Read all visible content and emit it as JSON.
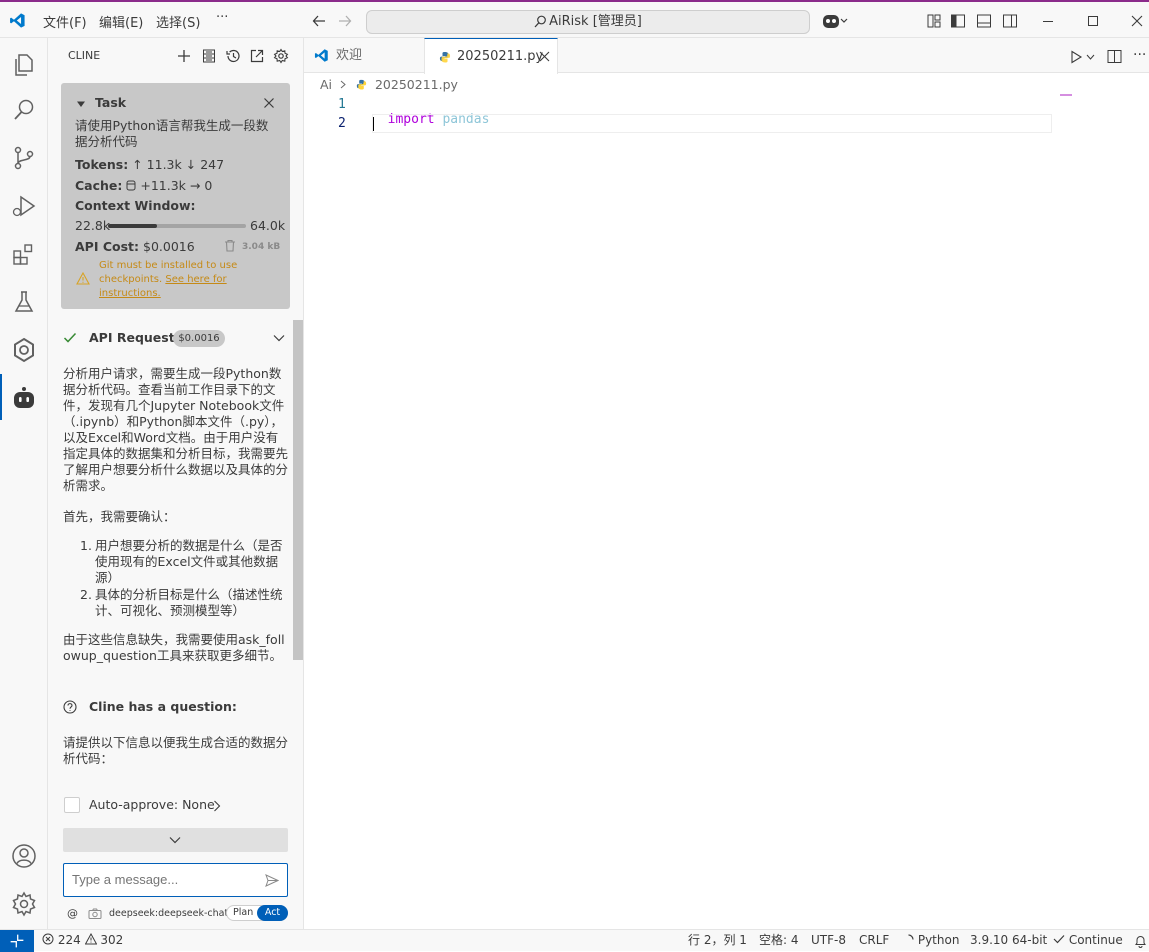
{
  "titlebar": {
    "menus": [
      "文件(F)",
      "编辑(E)",
      "选择(S)",
      "···"
    ],
    "command_center": "AiRisk [管理员]"
  },
  "activity": {
    "items": [
      "explorer-icon",
      "search-icon",
      "source-control-icon",
      "run-debug-icon",
      "extensions-icon",
      "testing-icon",
      "openai-icon",
      "cline-icon"
    ],
    "bottom": [
      "account-icon",
      "settings-gear-icon"
    ]
  },
  "cline": {
    "header": "CLINE",
    "task": {
      "title": "Task",
      "text": "请使用Python语言帮我生成一段数据分析代码",
      "tokens_label": "Tokens:",
      "tokens_up": "↑ 11.3k",
      "tokens_down": "↓ 247",
      "cache_label": "Cache:",
      "cache_value": "+11.3k → 0",
      "context_label": "Context Window:",
      "context_used": "22.8k",
      "context_max": "64.0k",
      "context_fraction": 0.356,
      "cost_label": "API Cost:",
      "cost_value": "$0.0016",
      "size": "3.04 kB",
      "git_warning": "Git must be installed to use checkpoints.",
      "git_link": "See here for instructions."
    },
    "api_request": {
      "label": "API Request",
      "cost": "$0.0016"
    },
    "message": {
      "p1": "分析用户请求，需要生成一段Python数据分析代码。查看当前工作目录下的文件，发现有几个Jupyter Notebook文件（.ipynb）和Python脚本文件（.py），以及Excel和Word文档。由于用户没有指定具体的数据集和分析目标，我需要先了解用户想要分析什么数据以及具体的分析需求。",
      "p2": "首先，我需要确认：",
      "li1": "用户想要分析的数据是什么（是否使用现有的Excel文件或其他数据源）",
      "li2": "具体的分析目标是什么（描述性统计、可视化、预测模型等）",
      "p3": "由于这些信息缺失，我需要使用ask_followup_question工具来获取更多细节。",
      "question_label": "Cline has a question:",
      "question": "请提供以下信息以便我生成合适的数据分析代码："
    },
    "auto_approve": "Auto-approve: None",
    "input_placeholder": "Type a message...",
    "model": "deepseek:deepseek-chat",
    "mode_plan": "Plan",
    "mode_act": "Act"
  },
  "editor": {
    "tabs": [
      {
        "label": "欢迎"
      },
      {
        "label": "20250211.py"
      }
    ],
    "breadcrumb": [
      "Ai",
      "20250211.py"
    ],
    "lines": [
      {
        "num": "1",
        "keyword": "import",
        "rest": "pandas"
      },
      {
        "num": "2",
        "keyword": "",
        "rest": ""
      }
    ]
  },
  "status": {
    "errors": "224",
    "warnings": "302",
    "position": "行 2，列 1",
    "spaces": "空格: 4",
    "encoding": "UTF-8",
    "eol": "CRLF",
    "language": "Python",
    "interpreter": "3.9.10 64-bit",
    "continue": "Continue"
  },
  "colors": {
    "accent": "#005fb8",
    "keyword": "#af00db",
    "module": "#8ec6d8",
    "warning": "#d8a326"
  }
}
